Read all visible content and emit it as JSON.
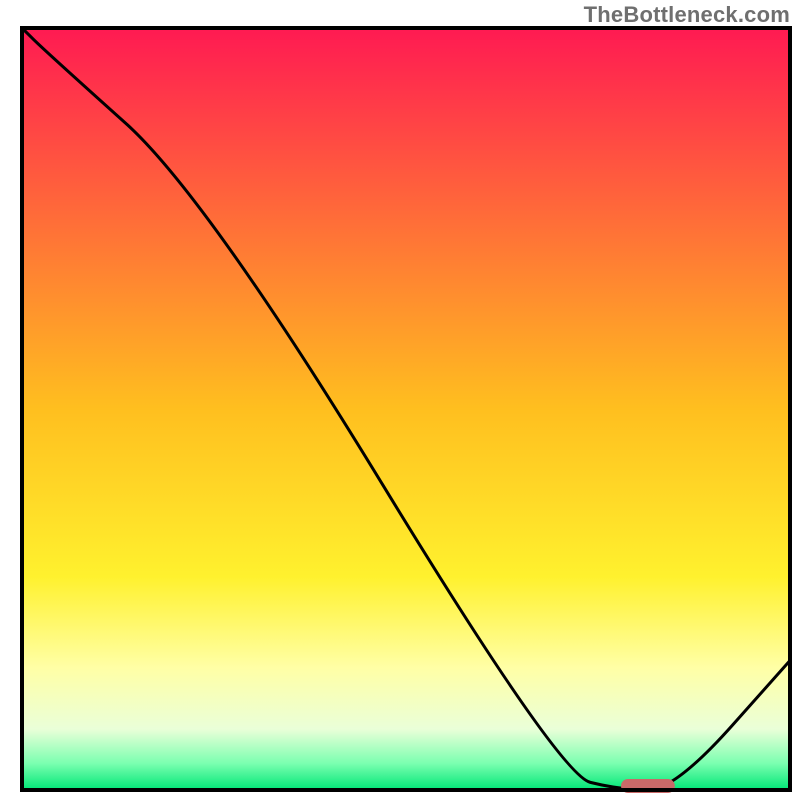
{
  "watermark": "TheBottleneck.com",
  "chart_data": {
    "type": "line",
    "title": "",
    "xlabel": "",
    "ylabel": "",
    "xlim": [
      0,
      100
    ],
    "ylim": [
      0,
      100
    ],
    "x": [
      0,
      3,
      24,
      70,
      78,
      85,
      100
    ],
    "values": [
      100,
      97,
      78,
      2,
      0,
      0,
      17
    ],
    "marker": {
      "x_start": 78,
      "x_end": 85,
      "y": 0
    },
    "gradient_stops": [
      {
        "offset": 0.0,
        "color": "#ff1a52"
      },
      {
        "offset": 0.5,
        "color": "#ffbf1f"
      },
      {
        "offset": 0.72,
        "color": "#fff12e"
      },
      {
        "offset": 0.84,
        "color": "#ffffa6"
      },
      {
        "offset": 0.92,
        "color": "#eaffd8"
      },
      {
        "offset": 0.965,
        "color": "#7bffb0"
      },
      {
        "offset": 1.0,
        "color": "#00e676"
      }
    ],
    "colors": {
      "curve": "#000000",
      "marker": "#c96968",
      "border": "#000000",
      "background": "#ffffff"
    }
  }
}
